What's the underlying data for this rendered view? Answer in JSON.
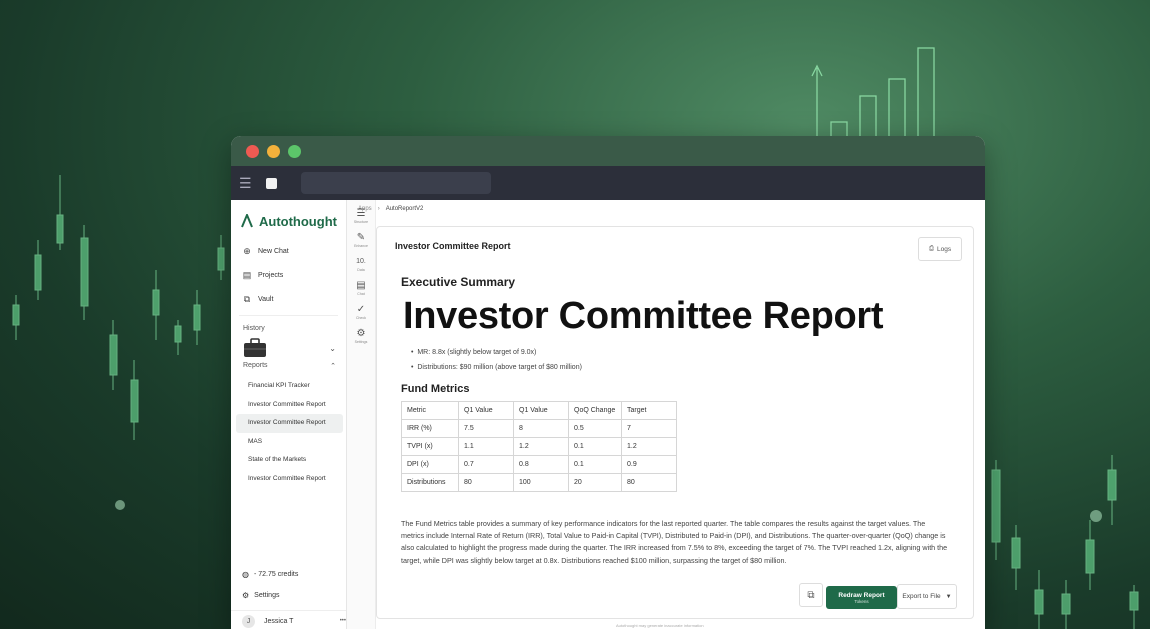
{
  "app": {
    "logo_text": "Autothought",
    "breadcrumb": [
      "Apps",
      "AutoReportV2"
    ],
    "breadcrumb_sep": "›"
  },
  "sidebar": {
    "nav": [
      {
        "label": "New Chat",
        "icon": "chat-plus-icon"
      },
      {
        "label": "Projects",
        "icon": "projects-icon"
      },
      {
        "label": "Vault",
        "icon": "vault-icon"
      }
    ],
    "history_label": "History",
    "reports_label": "Reports",
    "reports": [
      "Financial KPI Tracker",
      "Investor Committee Report",
      "Investor Committee Report",
      "MAS",
      "State of the Markets",
      "Investor Committee Report"
    ],
    "active_report_index": 2,
    "credits": "- 72.75 credits",
    "settings_label": "Settings",
    "user_name": "Jessica T",
    "user_initial": "J",
    "more_dots": "•••"
  },
  "rail": [
    {
      "icon": "list-icon",
      "label": "Structure",
      "glyph": "☰"
    },
    {
      "icon": "magic-wand-icon",
      "label": "Enhance",
      "glyph": "✎"
    },
    {
      "icon": "data-icon",
      "label": "Data",
      "glyph": "10."
    },
    {
      "icon": "comment-icon",
      "label": "Chat",
      "glyph": "▤"
    },
    {
      "icon": "check-icon",
      "label": "Check",
      "glyph": "✓"
    },
    {
      "icon": "gear-icon",
      "label": "Settings",
      "glyph": "⚙"
    }
  ],
  "report": {
    "doc_title": "Investor Committee Report",
    "logs_label": "Logs",
    "section1": "Executive Summary",
    "hero_title": "Investor Committee Report",
    "bullets": [
      "MR: 8.8x (slightly below target of 9.0x)",
      "Distributions: $90 million (above target of $80 million)"
    ],
    "section2": "Fund Metrics",
    "table": {
      "headers": [
        "Metric",
        "Q1 Value",
        "Q1 Value",
        "QoQ Change",
        "Target"
      ],
      "rows": [
        [
          "IRR (%)",
          "7.5",
          "8",
          "0.5",
          "7"
        ],
        [
          "TVPI (x)",
          "1.1",
          "1.2",
          "0.1",
          "1.2"
        ],
        [
          "DPI (x)",
          "0.7",
          "0.8",
          "0.1",
          "0.9"
        ],
        [
          "Distributions",
          "80",
          "100",
          "20",
          "80"
        ]
      ]
    },
    "paragraph": "The Fund Metrics table provides a summary of key performance indicators for the last reported quarter. The table compares the results against the target values. The metrics include Internal Rate of Return (IRR), Total Value to Paid-in Capital (TVPI), Distributed to Paid-in (DPI), and Distributions. The quarter-over-quarter (QoQ) change is also calculated to highlight the progress made during the quarter. The IRR increased from 7.5% to 8%, exceeding the target of 7%. The TVPI reached 1.2x, aligning with the target, while DPI was slightly below target at 0.8x. Distributions reached $100 million, surpassing the target of $80 million.",
    "redraw_label": "Redraw Report",
    "redraw_sub": "Tokens",
    "export_label": "Export to File",
    "footer_note": "Autothought may generate inaccurate information"
  }
}
